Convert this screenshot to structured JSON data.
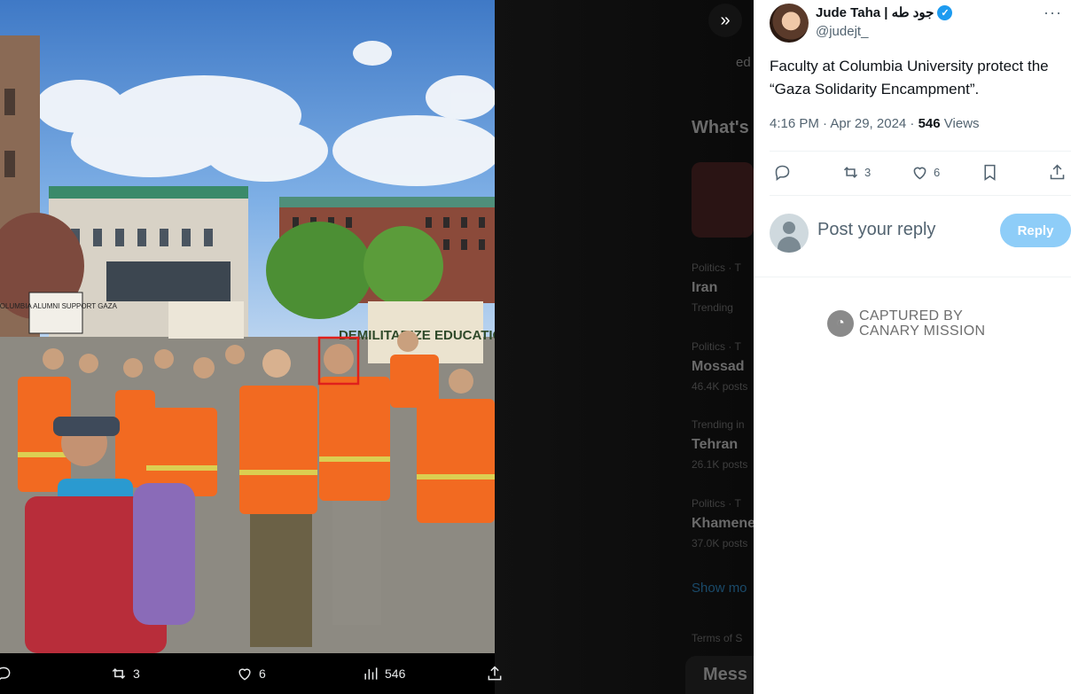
{
  "viewer": {
    "actions": {
      "replies": "",
      "retweets": "3",
      "likes": "6",
      "views": "546"
    }
  },
  "background_page": {
    "search_fragment": "ed",
    "whats_happening": "What's",
    "trends": [
      {
        "category": "Politics · T",
        "name": "Iran",
        "meta": "Trending"
      },
      {
        "category": "Politics · T",
        "name": "Mossad",
        "meta": "46.4K posts"
      },
      {
        "category": "Trending in",
        "name": "Tehran",
        "meta": "26.1K posts"
      },
      {
        "category": "Politics · T",
        "name": "Khamene",
        "meta": "37.0K posts"
      }
    ],
    "show_more": "Show mo",
    "terms": "Terms of S",
    "messages": "Mess"
  },
  "photo": {
    "signs": [
      "COLUMBIA ALUMNI SUPPORT GAZA",
      "DEMILITARIZE EDUCATION"
    ]
  },
  "tweet": {
    "author_name": "Jude Taha | جود طه",
    "handle": "@judejt_",
    "more_label": "···",
    "text": "Faculty at Columbia University protect the “Gaza Solidarity Encampment”.",
    "time": "4:16 PM · Apr 29, 2024 · ",
    "views_count": "546",
    "views_label": " Views",
    "retweets": "3",
    "likes": "6"
  },
  "reply": {
    "placeholder": "Post your reply",
    "button_label": "Reply"
  },
  "watermark": {
    "line1": "CAPTURED BY",
    "line2": "CANARY MISSION"
  },
  "colors": {
    "accent": "#1d9bf0",
    "reply_button": "#8ecdf8",
    "vest_orange": "#f26a21",
    "highlight_box": "#e0201c"
  }
}
